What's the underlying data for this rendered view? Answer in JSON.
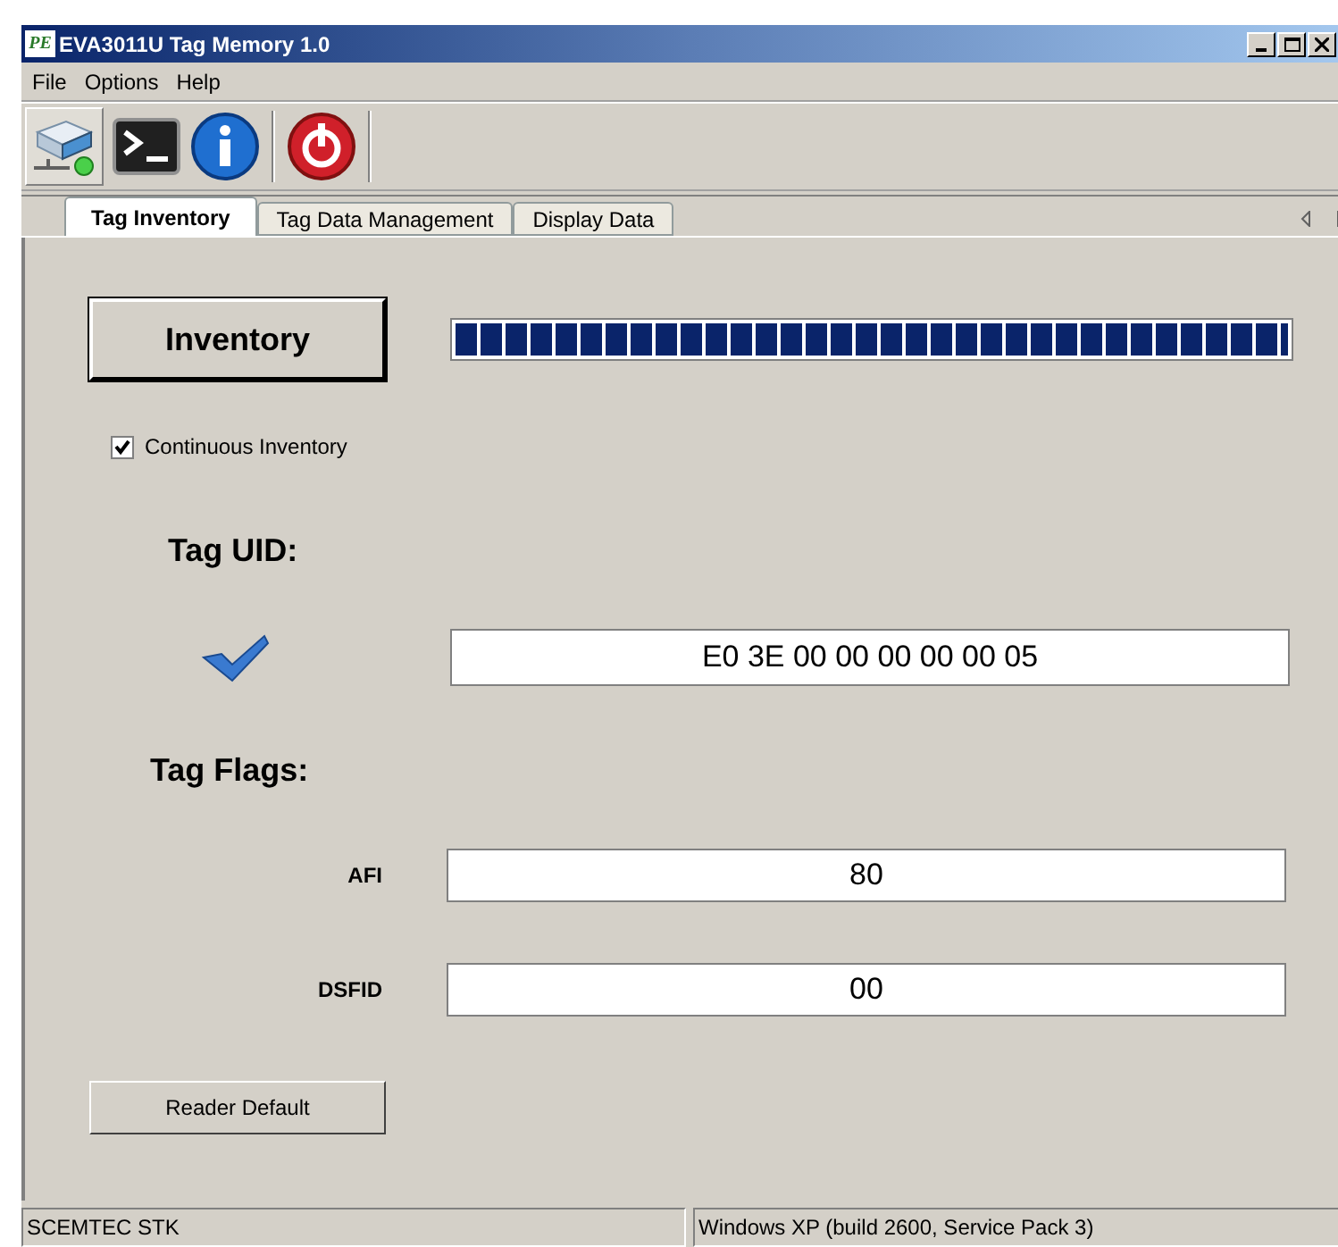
{
  "window": {
    "logo": "PE",
    "title": "EVA3011U Tag Memory 1.0"
  },
  "menu": [
    "File",
    "Options",
    "Help"
  ],
  "tabs": [
    {
      "label": "Tag Inventory",
      "selected": true
    },
    {
      "label": "Tag Data Management",
      "selected": false
    },
    {
      "label": "Display Data",
      "selected": false
    }
  ],
  "inventory_button": "Inventory",
  "progress": {
    "level": 1
  },
  "continuous": {
    "label": "Continuous Inventory",
    "checked": true
  },
  "uid_heading": "Tag UID:",
  "uid_value": "E0 3E 00 00 00 00 00 05",
  "flags_heading": "Tag Flags:",
  "flags": [
    {
      "label": "AFI",
      "value": "80"
    },
    {
      "label": "DSFID",
      "value": "00"
    }
  ],
  "reader_default_button": "Reader Default",
  "status_bar": [
    "SCEMTEC STK",
    "Windows XP (build 2600, Service Pack 3)"
  ]
}
